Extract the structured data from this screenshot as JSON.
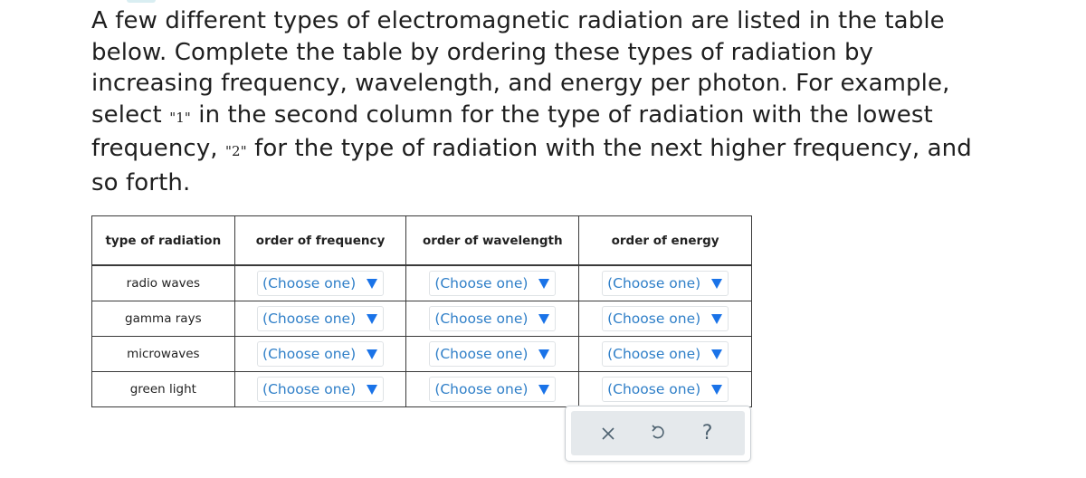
{
  "prompt": {
    "part1": "A few different types of electromagnetic radiation are listed in the table below. Complete the table by ordering these types of radiation by increasing frequency, wavelength, and energy per photon. For example, select ",
    "q1": "\"1\"",
    "part2": " in the second column for the type of radiation with the lowest frequency, ",
    "q2": "\"2\"",
    "part3": " for the type of radiation with the next higher frequency, and so forth."
  },
  "table": {
    "headers": [
      "type of radiation",
      "order of frequency",
      "order of wavelength",
      "order of energy"
    ],
    "rows": [
      {
        "type": "radio waves",
        "frequency": "(Choose one)",
        "wavelength": "(Choose one)",
        "energy": "(Choose one)"
      },
      {
        "type": "gamma rays",
        "frequency": "(Choose one)",
        "wavelength": "(Choose one)",
        "energy": "(Choose one)"
      },
      {
        "type": "microwaves",
        "frequency": "(Choose one)",
        "wavelength": "(Choose one)",
        "energy": "(Choose one)"
      },
      {
        "type": "green light",
        "frequency": "(Choose one)",
        "wavelength": "(Choose one)",
        "energy": "(Choose one)"
      }
    ]
  },
  "toolbar": {
    "clear_icon": "close-icon",
    "undo_icon": "undo-icon",
    "help_label": "?"
  },
  "colors": {
    "select_text": "#2f7fc8",
    "select_arrow": "#1a73e8",
    "toolbar_bg": "#e5e9ec",
    "toolbar_icon": "#4e6270"
  }
}
